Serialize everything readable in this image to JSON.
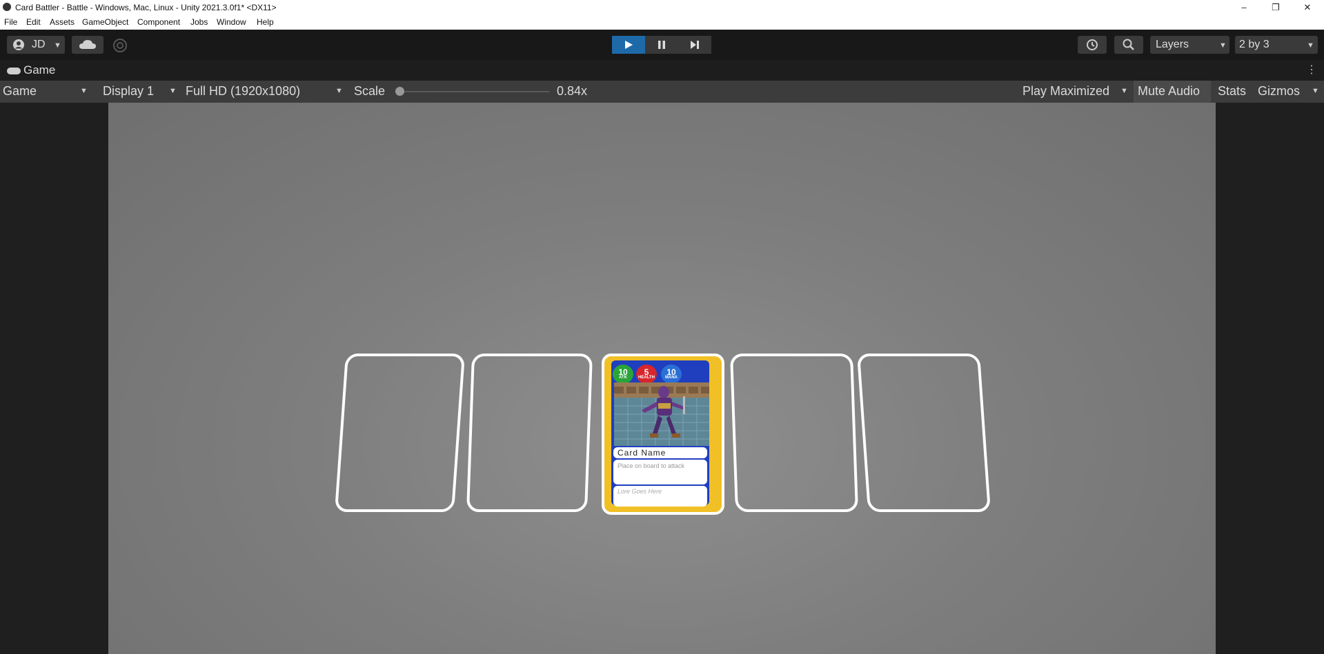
{
  "window": {
    "title": "Card Battler - Battle - Windows, Mac, Linux - Unity 2021.3.0f1* <DX11>",
    "minimize": "–",
    "restore": "❐",
    "close": "✕"
  },
  "menu": [
    "File",
    "Edit",
    "Assets",
    "GameObject",
    "Component",
    "Jobs",
    "Window",
    "Help"
  ],
  "toolbar": {
    "account": "JD",
    "layers_label": "Layers",
    "layout_label": "2 by 3"
  },
  "tab": {
    "label": "Game"
  },
  "gamebar": {
    "view": "Game",
    "display": "Display 1",
    "resolution": "Full HD (1920x1080)",
    "scale_label": "Scale",
    "scale_value": "0.84x",
    "play_mode": "Play Maximized",
    "mute": "Mute Audio",
    "stats": "Stats",
    "gizmos": "Gizmos"
  },
  "card": {
    "attack": "10",
    "attack_label": "ATK",
    "health": "5",
    "health_label": "HEALTH",
    "mana": "10",
    "mana_label": "MANA",
    "name": "Card Name",
    "description": "Place on board to attack",
    "lore": "Lore Goes Here"
  },
  "colors": {
    "play_active": "#1e6aa8",
    "card_border": "#f1c026",
    "card_body": "#1f3fbf",
    "attack": "#2aa53a",
    "health": "#d8262c",
    "mana": "#2a6fd6"
  }
}
